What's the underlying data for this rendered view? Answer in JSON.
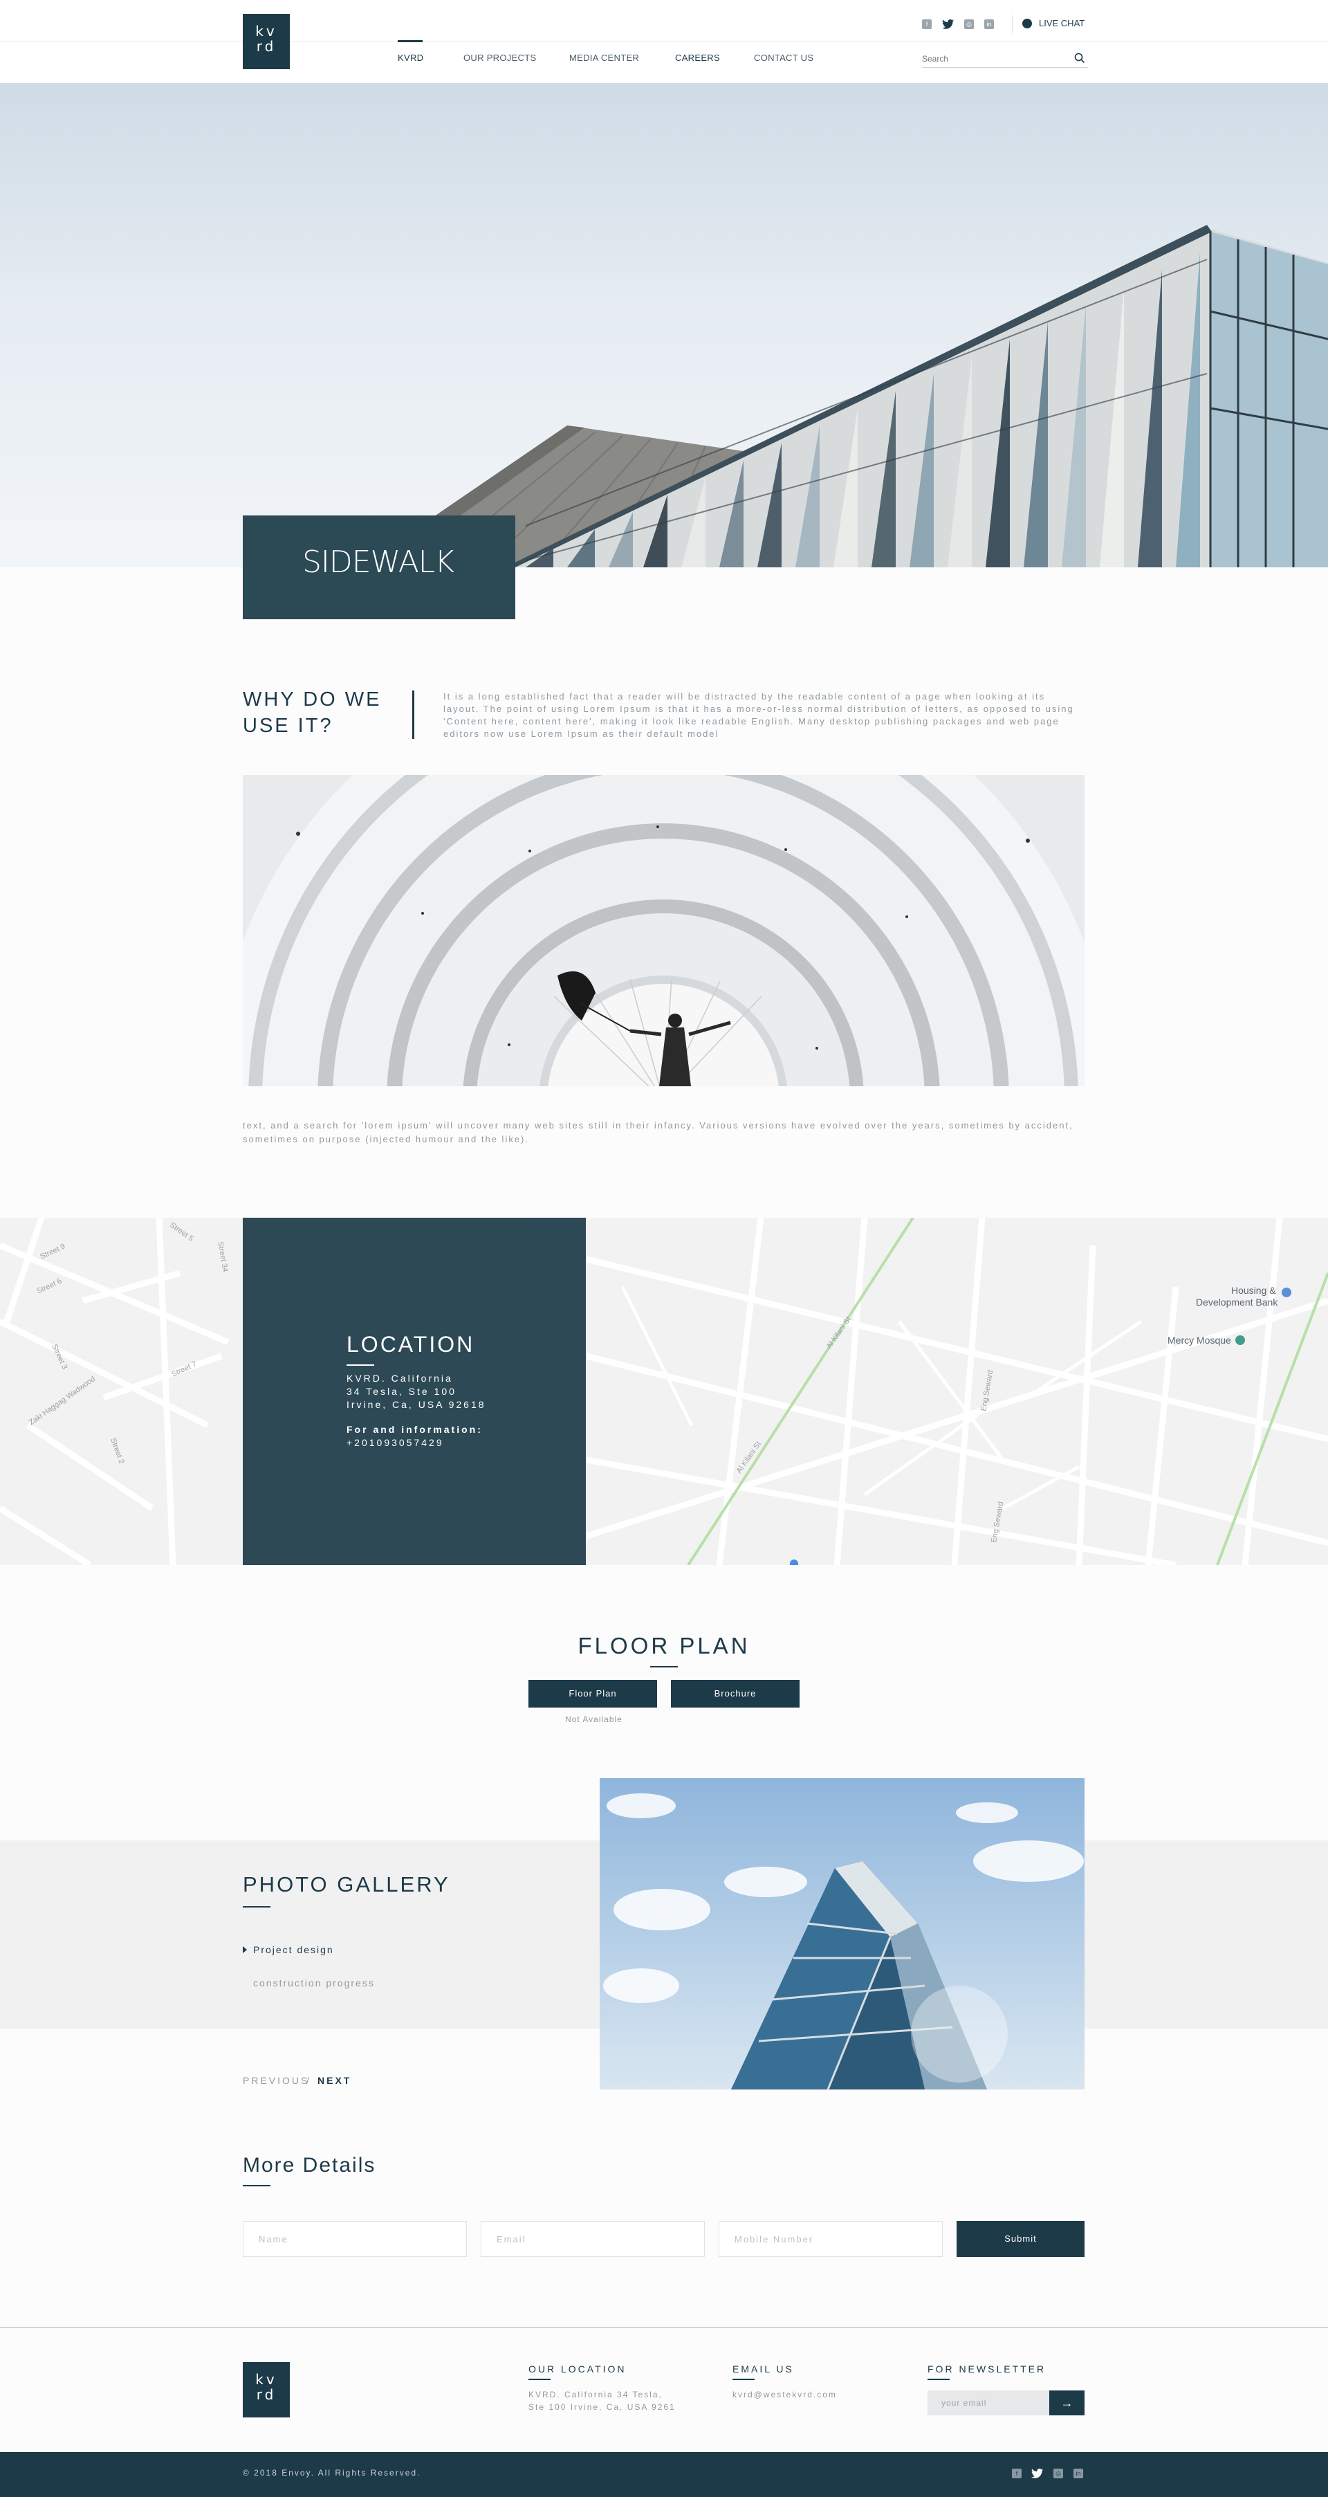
{
  "header": {
    "logo": [
      "kv",
      "rd"
    ],
    "nav": [
      "KVRD",
      "OUR PROJECTS",
      "MEDIA CENTER",
      "CAREERS",
      "CONTACT US"
    ],
    "live_chat": "LIVE CHAT",
    "search_placeholder": "Search",
    "social": [
      "facebook-icon",
      "twitter-icon",
      "instagram-icon",
      "linkedin-icon"
    ]
  },
  "hero": {
    "title": "SIDEWALK"
  },
  "why": {
    "title_line1": "WHY DO WE",
    "title_line2": "USE IT?",
    "text": "It is a long established fact that a reader will be distracted by the readable content of a page when looking at its layout. The point of using Lorem Ipsum is that it has a more-or-less normal distribution of letters, as opposed to using 'Content here, content here', making it look like readable English. Many desktop publishing packages and web page editors now use Lorem Ipsum as their default model",
    "text2": "text, and a search for 'lorem ipsum' will uncover many web sites still in their infancy. Various versions have evolved over the years, sometimes by accident, sometimes on purpose (injected humour and the like)."
  },
  "location": {
    "title": "LOCATION",
    "address_line1": "KVRD. California",
    "address_line2": "34 Tesla, Ste 100",
    "address_line3": "Irvine, Ca, USA 92618",
    "info_label": "For and information:",
    "phone": "+201093057429",
    "map_labels": {
      "bank": "Housing &",
      "bank2": "Development Bank",
      "mosque": "Mercy Mosque",
      "streets": [
        "Street 9",
        "Street 6",
        "Street 5",
        "Street 34",
        "Street 7",
        "Street 3",
        "Zaki Haggag Wadwood",
        "Street 2",
        "Al Kilani St",
        "Al Kilani St",
        "Eng Seward",
        "Eng Seward"
      ]
    }
  },
  "floor_plan": {
    "title": "FLOOR PLAN",
    "btn_floor": "Floor Plan",
    "btn_brochure": "Brochure",
    "not_available": "Not Available"
  },
  "gallery": {
    "title": "PHOTO GALLERY",
    "item1": "Project design",
    "item2": "construction progress",
    "previous": "PREVIOUS",
    "separator": "/",
    "next": "NEXT"
  },
  "details": {
    "title": "More Details",
    "name_placeholder": "Name",
    "email_placeholder": "Email",
    "mobile_placeholder": "Mobile Number",
    "submit": "Submit"
  },
  "footer": {
    "location_title": "OUR LOCATION",
    "location_line1": "KVRD. California 34 Tesla,",
    "location_line2": "Ste 100 Irvine, Ca, USA 9261",
    "email_title": "EMAIL US",
    "email": "kvrd@westekvrd.com",
    "newsletter_title": "FOR NEWSLETTER",
    "newsletter_placeholder": "your email",
    "copyright": "© 2018 Envoy. All Rights Reserved."
  },
  "colors": {
    "primary": "#1d3a48",
    "card": "#2c4a55",
    "muted_text": "#8f9aa2"
  }
}
